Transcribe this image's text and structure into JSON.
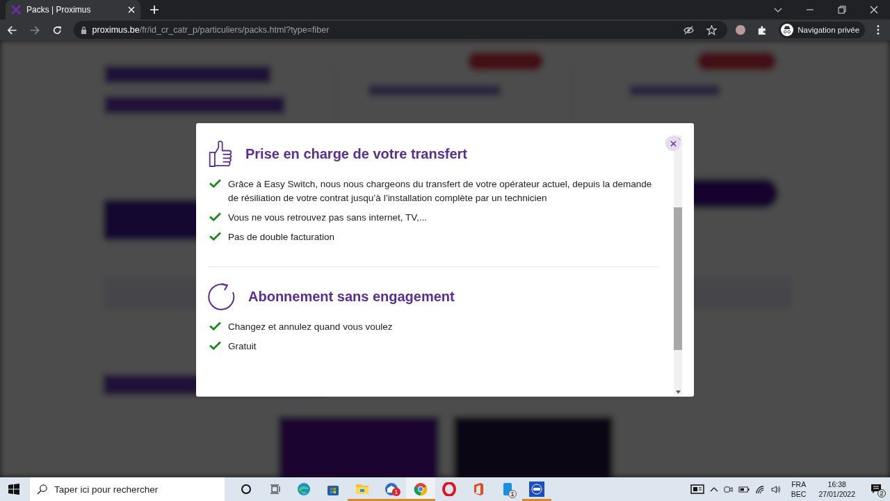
{
  "browser": {
    "tab_title": "Packs | Proximus",
    "url_host": "proximus.be",
    "url_path": "/fr/id_cr_catr_p/particuliers/packs.html?type=fiber",
    "profile_label": "Navigation privée"
  },
  "modal": {
    "sections": [
      {
        "kind": "thumbs_up",
        "title": "Prise en charge de votre transfert",
        "items": [
          "Grâce à Easy Switch, nous nous chargeons du transfert de votre opérateur actuel, depuis la demande de résiliation de votre contrat jusqu’à l’installation complète par un technicien",
          "Vous ne vous retrouvez pas sans internet, TV,...",
          "Pas de double facturation"
        ]
      },
      {
        "kind": "refresh",
        "title": "Abonnement sans engagement",
        "items": [
          "Changez et annulez quand vous voulez",
          "Gratuit"
        ]
      }
    ]
  },
  "taskbar": {
    "search_placeholder": "Taper ici pour rechercher",
    "apps": [
      {
        "kind": "cortana",
        "running": false,
        "selected": false
      },
      {
        "kind": "taskview",
        "running": false,
        "selected": false
      },
      {
        "kind": "edge",
        "running": false,
        "selected": false
      },
      {
        "kind": "store",
        "running": false,
        "selected": false
      },
      {
        "kind": "files",
        "running": true,
        "selected": false
      },
      {
        "kind": "mail",
        "running": true,
        "selected": false,
        "badge": "1"
      },
      {
        "kind": "chrome",
        "running": true,
        "selected": true
      },
      {
        "kind": "opera",
        "running": false,
        "selected": false
      },
      {
        "kind": "office",
        "running": false,
        "selected": false
      },
      {
        "kind": "phone",
        "running": false,
        "selected": false,
        "badge": "1"
      },
      {
        "kind": "remote",
        "running": true,
        "selected": false
      }
    ],
    "language": "FRA",
    "layout": "BEC",
    "time": "16:38",
    "date": "27/01/2022",
    "notifications": "2"
  }
}
